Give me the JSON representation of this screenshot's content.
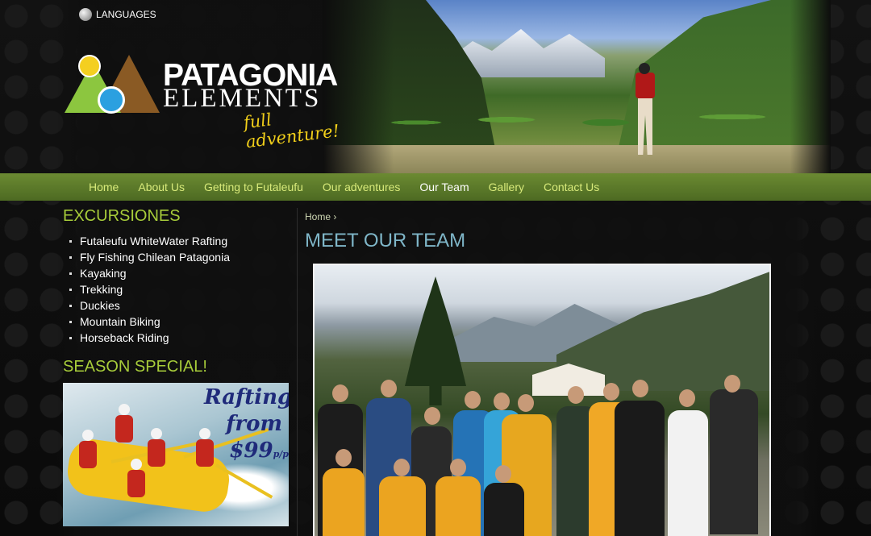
{
  "header": {
    "languages_label": "LANGUAGES",
    "logo": {
      "line1": "PATAGONIA",
      "line2": "ELEMENTS",
      "tagline": "full adventure!"
    }
  },
  "nav": {
    "items": [
      {
        "label": "Home",
        "active": false
      },
      {
        "label": "About Us",
        "active": false
      },
      {
        "label": "Getting to Futaleufu",
        "active": false
      },
      {
        "label": "Our adventures",
        "active": false
      },
      {
        "label": "Our Team",
        "active": true
      },
      {
        "label": "Gallery",
        "active": false
      },
      {
        "label": "Contact Us",
        "active": false
      }
    ]
  },
  "sidebar": {
    "excursions_title": "EXCURSIONES",
    "excursions": [
      "Futaleufu WhiteWater Rafting",
      "Fly Fishing Chilean Patagonia",
      "Kayaking",
      "Trekking",
      "Duckies",
      "Mountain Biking",
      "Horseback Riding"
    ],
    "special_title": "SEASON SPECIAL!",
    "promo": {
      "line1": "Rafting",
      "line2": "from",
      "price": "$99",
      "unit": "p/p"
    }
  },
  "main": {
    "breadcrumb": {
      "home": "Home",
      "separator": "›"
    },
    "title": "MEET OUR TEAM"
  },
  "colors": {
    "nav_bg": "#5b7a2a",
    "nav_text": "#d8ea7a",
    "accent_green": "#a7cc3a",
    "title_blue": "#7fb6c8",
    "logo_yellow": "#f1cf1a"
  },
  "icons": {
    "languages": "globe-icon"
  }
}
